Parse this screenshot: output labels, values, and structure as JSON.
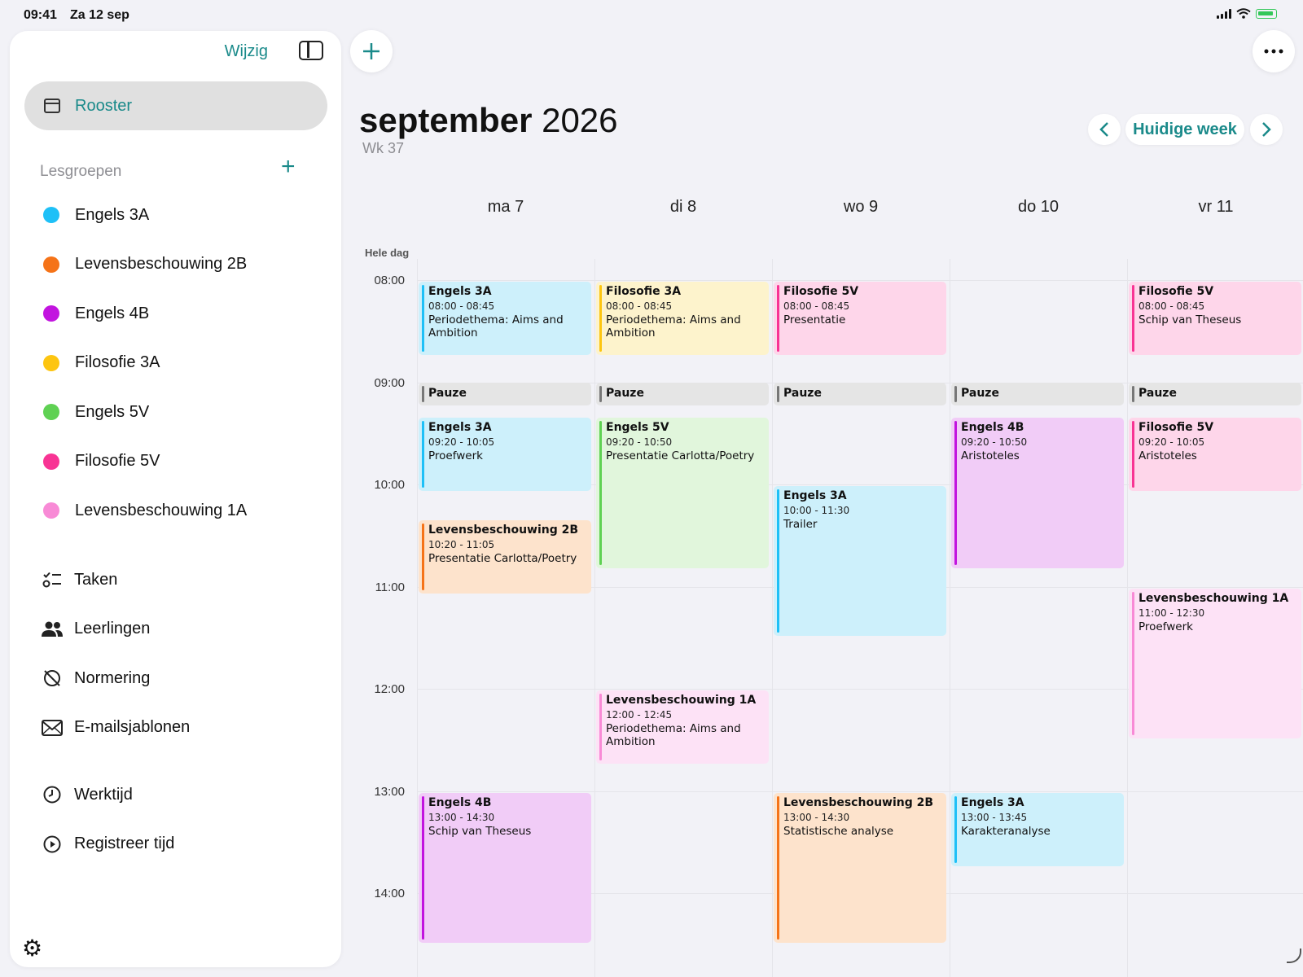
{
  "status": {
    "time": "09:41",
    "date": "Za 12 sep"
  },
  "sidebar": {
    "edit_label": "Wijzig",
    "rooster_label": "Rooster",
    "section_title": "Lesgroepen",
    "groups": [
      {
        "label": "Engels 3A",
        "color": "#1ec0f7"
      },
      {
        "label": "Levensbeschouwing 2B",
        "color": "#f57318"
      },
      {
        "label": "Engels 4B",
        "color": "#c214df"
      },
      {
        "label": "Filosofie 3A",
        "color": "#fdc510"
      },
      {
        "label": "Engels 5V",
        "color": "#5fd153"
      },
      {
        "label": "Filosofie 5V",
        "color": "#f83494"
      },
      {
        "label": "Levensbeschouwing 1A",
        "color": "#f88ad6"
      }
    ],
    "nav": [
      {
        "label": "Taken",
        "icon": "checklist-icon"
      },
      {
        "label": "Leerlingen",
        "icon": "people-icon"
      },
      {
        "label": "Normering",
        "icon": "slash-circle-icon"
      },
      {
        "label": "E-mailsjablonen",
        "icon": "envelope-icon"
      }
    ],
    "nav2": [
      {
        "label": "Werktijd",
        "icon": "clock-icon"
      },
      {
        "label": "Registreer tijd",
        "icon": "play-circle-icon"
      }
    ]
  },
  "header": {
    "month": "september",
    "year": "2026",
    "week": "Wk 37",
    "current_week_label": "Huidige week"
  },
  "calendar": {
    "days": [
      "ma 7",
      "di 8",
      "wo 9",
      "do 10",
      "vr 11"
    ],
    "allday_label": "Hele dag",
    "hours": [
      "08:00",
      "09:00",
      "10:00",
      "11:00",
      "12:00",
      "13:00",
      "14:00"
    ],
    "pause_label": "Pauze",
    "events": [
      {
        "day": 0,
        "start": "08:00",
        "end": "08:45",
        "title": "Engels 3A",
        "time": "08:00 - 08:45",
        "desc": "Periodethema: Aims and Ambition",
        "group": 0
      },
      {
        "day": 1,
        "start": "08:00",
        "end": "08:45",
        "title": "Filosofie 3A",
        "time": "08:00 - 08:45",
        "desc": "Periodethema: Aims and Ambition",
        "group": 3
      },
      {
        "day": 2,
        "start": "08:00",
        "end": "08:45",
        "title": "Filosofie 5V",
        "time": "08:00 - 08:45",
        "desc": "Presentatie",
        "group": 5
      },
      {
        "day": 4,
        "start": "08:00",
        "end": "08:45",
        "title": "Filosofie 5V",
        "time": "08:00 - 08:45",
        "desc": "Schip van Theseus",
        "group": 5
      },
      {
        "day": 0,
        "start": "09:20",
        "end": "10:05",
        "title": "Engels 3A",
        "time": "09:20 - 10:05",
        "desc": "Proefwerk",
        "group": 0
      },
      {
        "day": 1,
        "start": "09:20",
        "end": "10:50",
        "title": "Engels 5V",
        "time": "09:20 - 10:50",
        "desc": "Presentatie Carlotta/Poetry",
        "group": 4
      },
      {
        "day": 3,
        "start": "09:20",
        "end": "10:50",
        "title": "Engels 4B",
        "time": "09:20 - 10:50",
        "desc": "Aristoteles",
        "group": 2
      },
      {
        "day": 4,
        "start": "09:20",
        "end": "10:05",
        "title": "Filosofie 5V",
        "time": "09:20 - 10:05",
        "desc": "Aristoteles",
        "group": 5
      },
      {
        "day": 2,
        "start": "10:00",
        "end": "11:30",
        "title": "Engels 3A",
        "time": "10:00 - 11:30",
        "desc": "Trailer",
        "group": 0
      },
      {
        "day": 0,
        "start": "10:20",
        "end": "11:05",
        "title": "Levensbeschouwing 2B",
        "time": "10:20 - 11:05",
        "desc": "Presentatie Carlotta/Poetry",
        "group": 1
      },
      {
        "day": 4,
        "start": "11:00",
        "end": "12:30",
        "title": "Levensbeschouwing 1A",
        "time": "11:00 - 12:30",
        "desc": "Proefwerk",
        "group": 6
      },
      {
        "day": 1,
        "start": "12:00",
        "end": "12:45",
        "title": "Levensbeschouwing 1A",
        "time": "12:00 - 12:45",
        "desc": "Periodethema: Aims and Ambition",
        "group": 6
      },
      {
        "day": 0,
        "start": "13:00",
        "end": "14:30",
        "title": "Engels 4B",
        "time": "13:00 - 14:30",
        "desc": "Schip van Theseus",
        "group": 2
      },
      {
        "day": 2,
        "start": "13:00",
        "end": "14:30",
        "title": "Levensbeschouwing 2B",
        "time": "13:00 - 14:30",
        "desc": "Statistische analyse",
        "group": 1
      },
      {
        "day": 3,
        "start": "13:00",
        "end": "13:45",
        "title": "Engels 3A",
        "time": "13:00 - 13:45",
        "desc": "Karakteranalyse",
        "group": 0
      }
    ]
  },
  "colors": {
    "accent": "#1a8a8a",
    "event_backgrounds": [
      "#cdf0fb",
      "#fde3cc",
      "#f1ccf7",
      "#fdf3cc",
      "#e1f6dc",
      "#fed6ea",
      "#fde2f6"
    ],
    "pause_bg": "#e5e5e5",
    "pause_bar": "#777777"
  }
}
